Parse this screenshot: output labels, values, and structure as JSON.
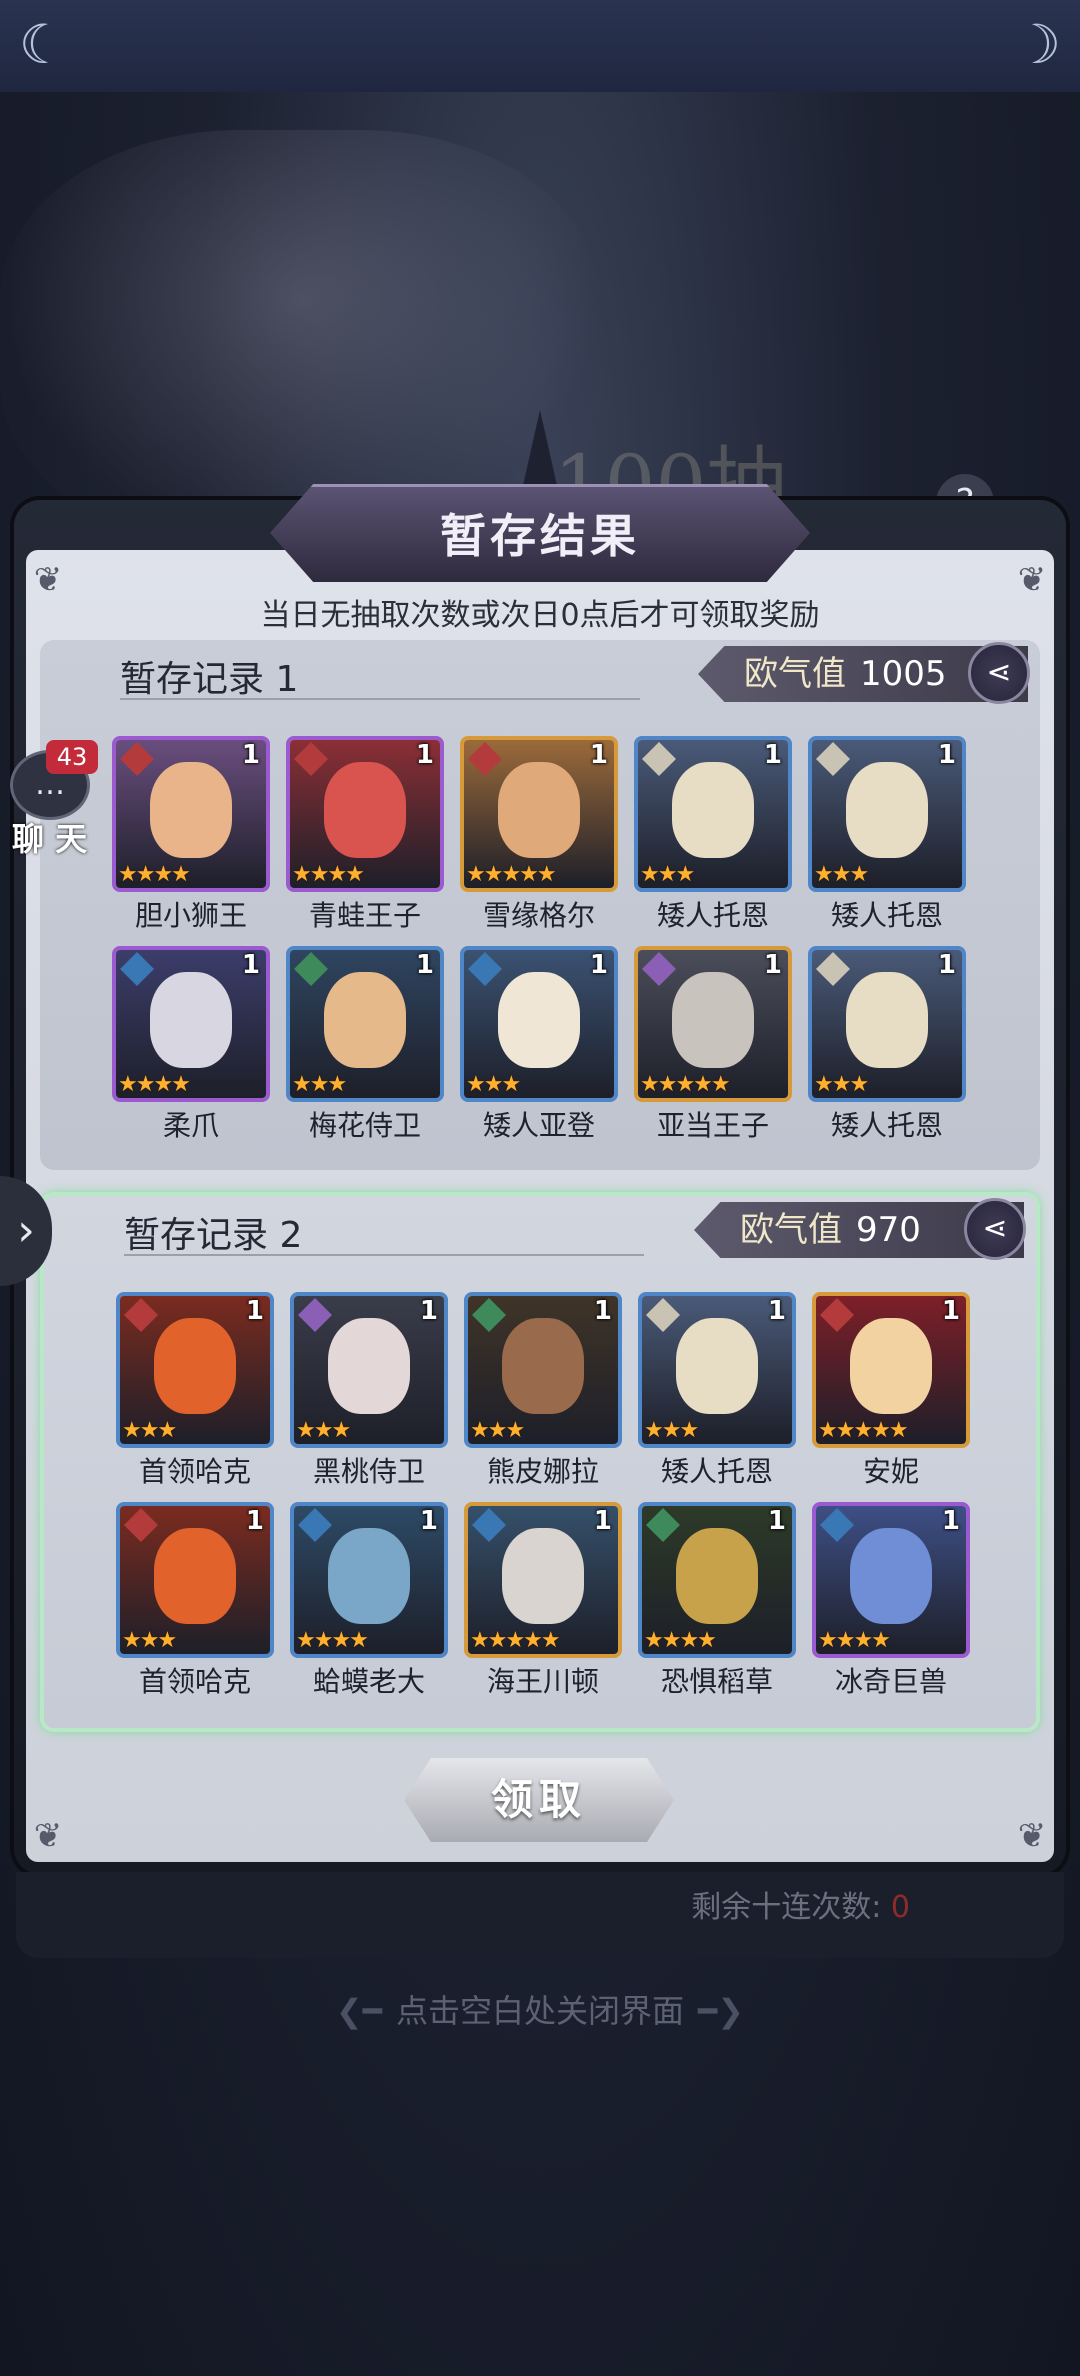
{
  "header": {
    "title": "暂存结果"
  },
  "background": {
    "banner_text": "100抽"
  },
  "notice": "当日无抽取次数或次日0点后才可领取奖励",
  "chat": {
    "label": "聊 天",
    "badge": "43"
  },
  "records": [
    {
      "title": "暂存记录 1",
      "luck_label": "欧气值",
      "luck_value": "1005",
      "heroes": [
        {
          "name": "胆小狮王",
          "count": "1",
          "stars": 4,
          "frame": "purple",
          "badge_color": "#b33b3b",
          "bg": "#6a4e7e",
          "skin": "#e9b48a"
        },
        {
          "name": "青蛙王子",
          "count": "1",
          "stars": 4,
          "frame": "purple",
          "badge_color": "#b33b3b",
          "bg": "#8b2f35",
          "skin": "#d9534f"
        },
        {
          "name": "雪缘格尔",
          "count": "1",
          "stars": 5,
          "frame": "gold",
          "badge_color": "#b33b3b",
          "bg": "#9b6a3a",
          "skin": "#e0a97a"
        },
        {
          "name": "矮人托恩",
          "count": "1",
          "stars": 3,
          "frame": "blue",
          "badge_color": "#c9c3b4",
          "bg": "#4a5a78",
          "skin": "#e7dcc4"
        },
        {
          "name": "矮人托恩",
          "count": "1",
          "stars": 3,
          "frame": "blue",
          "badge_color": "#c9c3b4",
          "bg": "#4a5a78",
          "skin": "#e7dcc4"
        },
        {
          "name": "柔爪",
          "count": "1",
          "stars": 4,
          "frame": "purple",
          "badge_color": "#3a77b5",
          "bg": "#3c3d6b",
          "skin": "#d8d6e0"
        },
        {
          "name": "梅花侍卫",
          "count": "1",
          "stars": 3,
          "frame": "blue",
          "badge_color": "#3e8a5a",
          "bg": "#2f4560",
          "skin": "#e6b98b"
        },
        {
          "name": "矮人亚登",
          "count": "1",
          "stars": 3,
          "frame": "blue",
          "badge_color": "#3a77b5",
          "bg": "#3b5272",
          "skin": "#efe6d6"
        },
        {
          "name": "亚当王子",
          "count": "1",
          "stars": 5,
          "frame": "gold",
          "badge_color": "#8a5fb5",
          "bg": "#4b4e5a",
          "skin": "#c8c3bd"
        },
        {
          "name": "矮人托恩",
          "count": "1",
          "stars": 3,
          "frame": "blue",
          "badge_color": "#c9c3b4",
          "bg": "#4a5a78",
          "skin": "#e7dcc4"
        }
      ]
    },
    {
      "title": "暂存记录 2",
      "luck_label": "欧气值",
      "luck_value": "970",
      "heroes": [
        {
          "name": "首领哈克",
          "count": "1",
          "stars": 3,
          "frame": "blue",
          "badge_color": "#b33b3b",
          "bg": "#7b2b1f",
          "skin": "#e2622c"
        },
        {
          "name": "黑桃侍卫",
          "count": "1",
          "stars": 3,
          "frame": "blue",
          "badge_color": "#8a5fb5",
          "bg": "#3a3d4a",
          "skin": "#e4d7d7"
        },
        {
          "name": "熊皮娜拉",
          "count": "1",
          "stars": 3,
          "frame": "blue",
          "badge_color": "#3e8a5a",
          "bg": "#3f3428",
          "skin": "#9a6a4c"
        },
        {
          "name": "矮人托恩",
          "count": "1",
          "stars": 3,
          "frame": "blue",
          "badge_color": "#c9c3b4",
          "bg": "#4a5a78",
          "skin": "#e7dcc4"
        },
        {
          "name": "安妮",
          "count": "1",
          "stars": 5,
          "frame": "gold",
          "badge_color": "#b33b3b",
          "bg": "#7e1f28",
          "skin": "#f1d2a0"
        },
        {
          "name": "首领哈克",
          "count": "1",
          "stars": 3,
          "frame": "blue",
          "badge_color": "#b33b3b",
          "bg": "#7b2b1f",
          "skin": "#e2622c"
        },
        {
          "name": "蛤蟆老大",
          "count": "1",
          "stars": 4,
          "frame": "blue",
          "badge_color": "#3a77b5",
          "bg": "#2d4a66",
          "skin": "#7aa6c8"
        },
        {
          "name": "海王川顿",
          "count": "1",
          "stars": 5,
          "frame": "gold",
          "badge_color": "#3a77b5",
          "bg": "#35506a",
          "skin": "#d9d4cf"
        },
        {
          "name": "恐惧稻草",
          "count": "1",
          "stars": 4,
          "frame": "blue",
          "badge_color": "#3e8a5a",
          "bg": "#2d3a28",
          "skin": "#c7a24a"
        },
        {
          "name": "冰奇巨兽",
          "count": "1",
          "stars": 4,
          "frame": "purple",
          "badge_color": "#3a77b5",
          "bg": "#3e4f86",
          "skin": "#6f8ed6"
        }
      ]
    }
  ],
  "claim_label": "领取",
  "remain": {
    "label": "剩余十连次数:",
    "value": "0"
  },
  "close_hint": "点击空白处关闭界面",
  "icons": {
    "share": "share-icon",
    "chat": "chat-bubble-icon",
    "arrow": "chevron-right-icon",
    "help": "question-icon"
  }
}
